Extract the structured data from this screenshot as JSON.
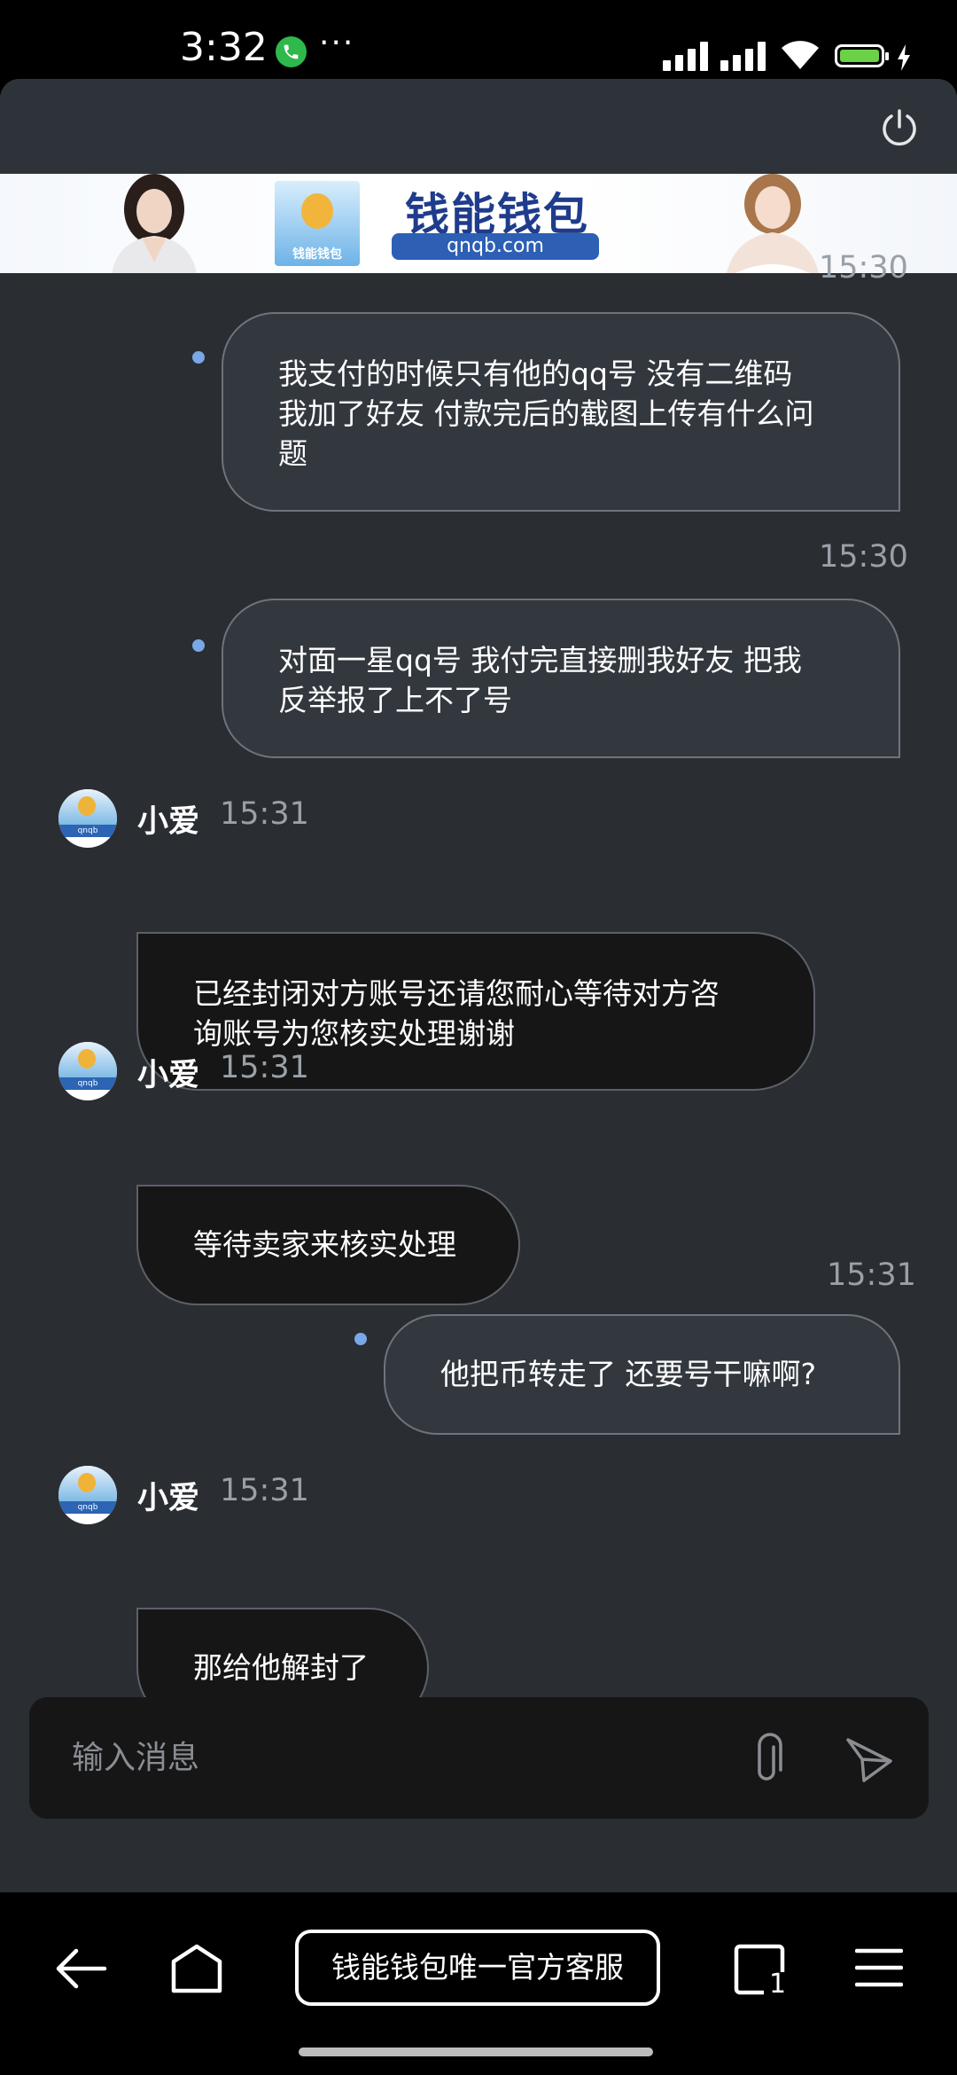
{
  "status_bar": {
    "time": "3:32",
    "dots": "···"
  },
  "banner": {
    "title": "钱能钱包",
    "url": "qnqb.com",
    "logo_text": "钱能钱包"
  },
  "messages": [
    {
      "type": "outgoing",
      "time": "15:30",
      "lines": [
        "我支付的时候只有他的qq号 没有二维码",
        "我加了好友 付款完后的截图上传有什么问",
        "题"
      ]
    },
    {
      "type": "outgoing",
      "time": "15:30",
      "lines": [
        "对面一星qq号 我付完直接删我好友 把我",
        "反举报了上不了号"
      ]
    },
    {
      "type": "incoming",
      "sender": "小爱",
      "time": "15:31",
      "lines": [
        "已经封闭对方账号还请您耐心等待对方咨",
        "询账号为您核实处理谢谢"
      ]
    },
    {
      "type": "incoming",
      "sender": "小爱",
      "time": "15:31",
      "lines": [
        "等待卖家来核实处理"
      ]
    },
    {
      "type": "outgoing",
      "time": "15:31",
      "lines": [
        "他把币转走了 还要号干嘛啊?"
      ]
    },
    {
      "type": "incoming",
      "sender": "小爱",
      "time": "15:31",
      "lines": [
        "那给他解封了"
      ]
    }
  ],
  "input": {
    "placeholder": "输入消息"
  },
  "browser_bar": {
    "page_title": "钱能钱包唯一官方客服",
    "tab_count": "1"
  },
  "icons": {
    "power": "power-icon",
    "attach": "paperclip-icon",
    "send": "send-icon",
    "back": "back-arrow-icon",
    "home": "home-icon",
    "tabs": "tabs-icon",
    "menu": "menu-icon"
  },
  "colors": {
    "app_bg": "#2a2d32",
    "header_bg": "#2e333a",
    "outgoing_bubble": "#33383f",
    "incoming_bubble": "#161616",
    "unread_dot": "#7aa7e8"
  }
}
